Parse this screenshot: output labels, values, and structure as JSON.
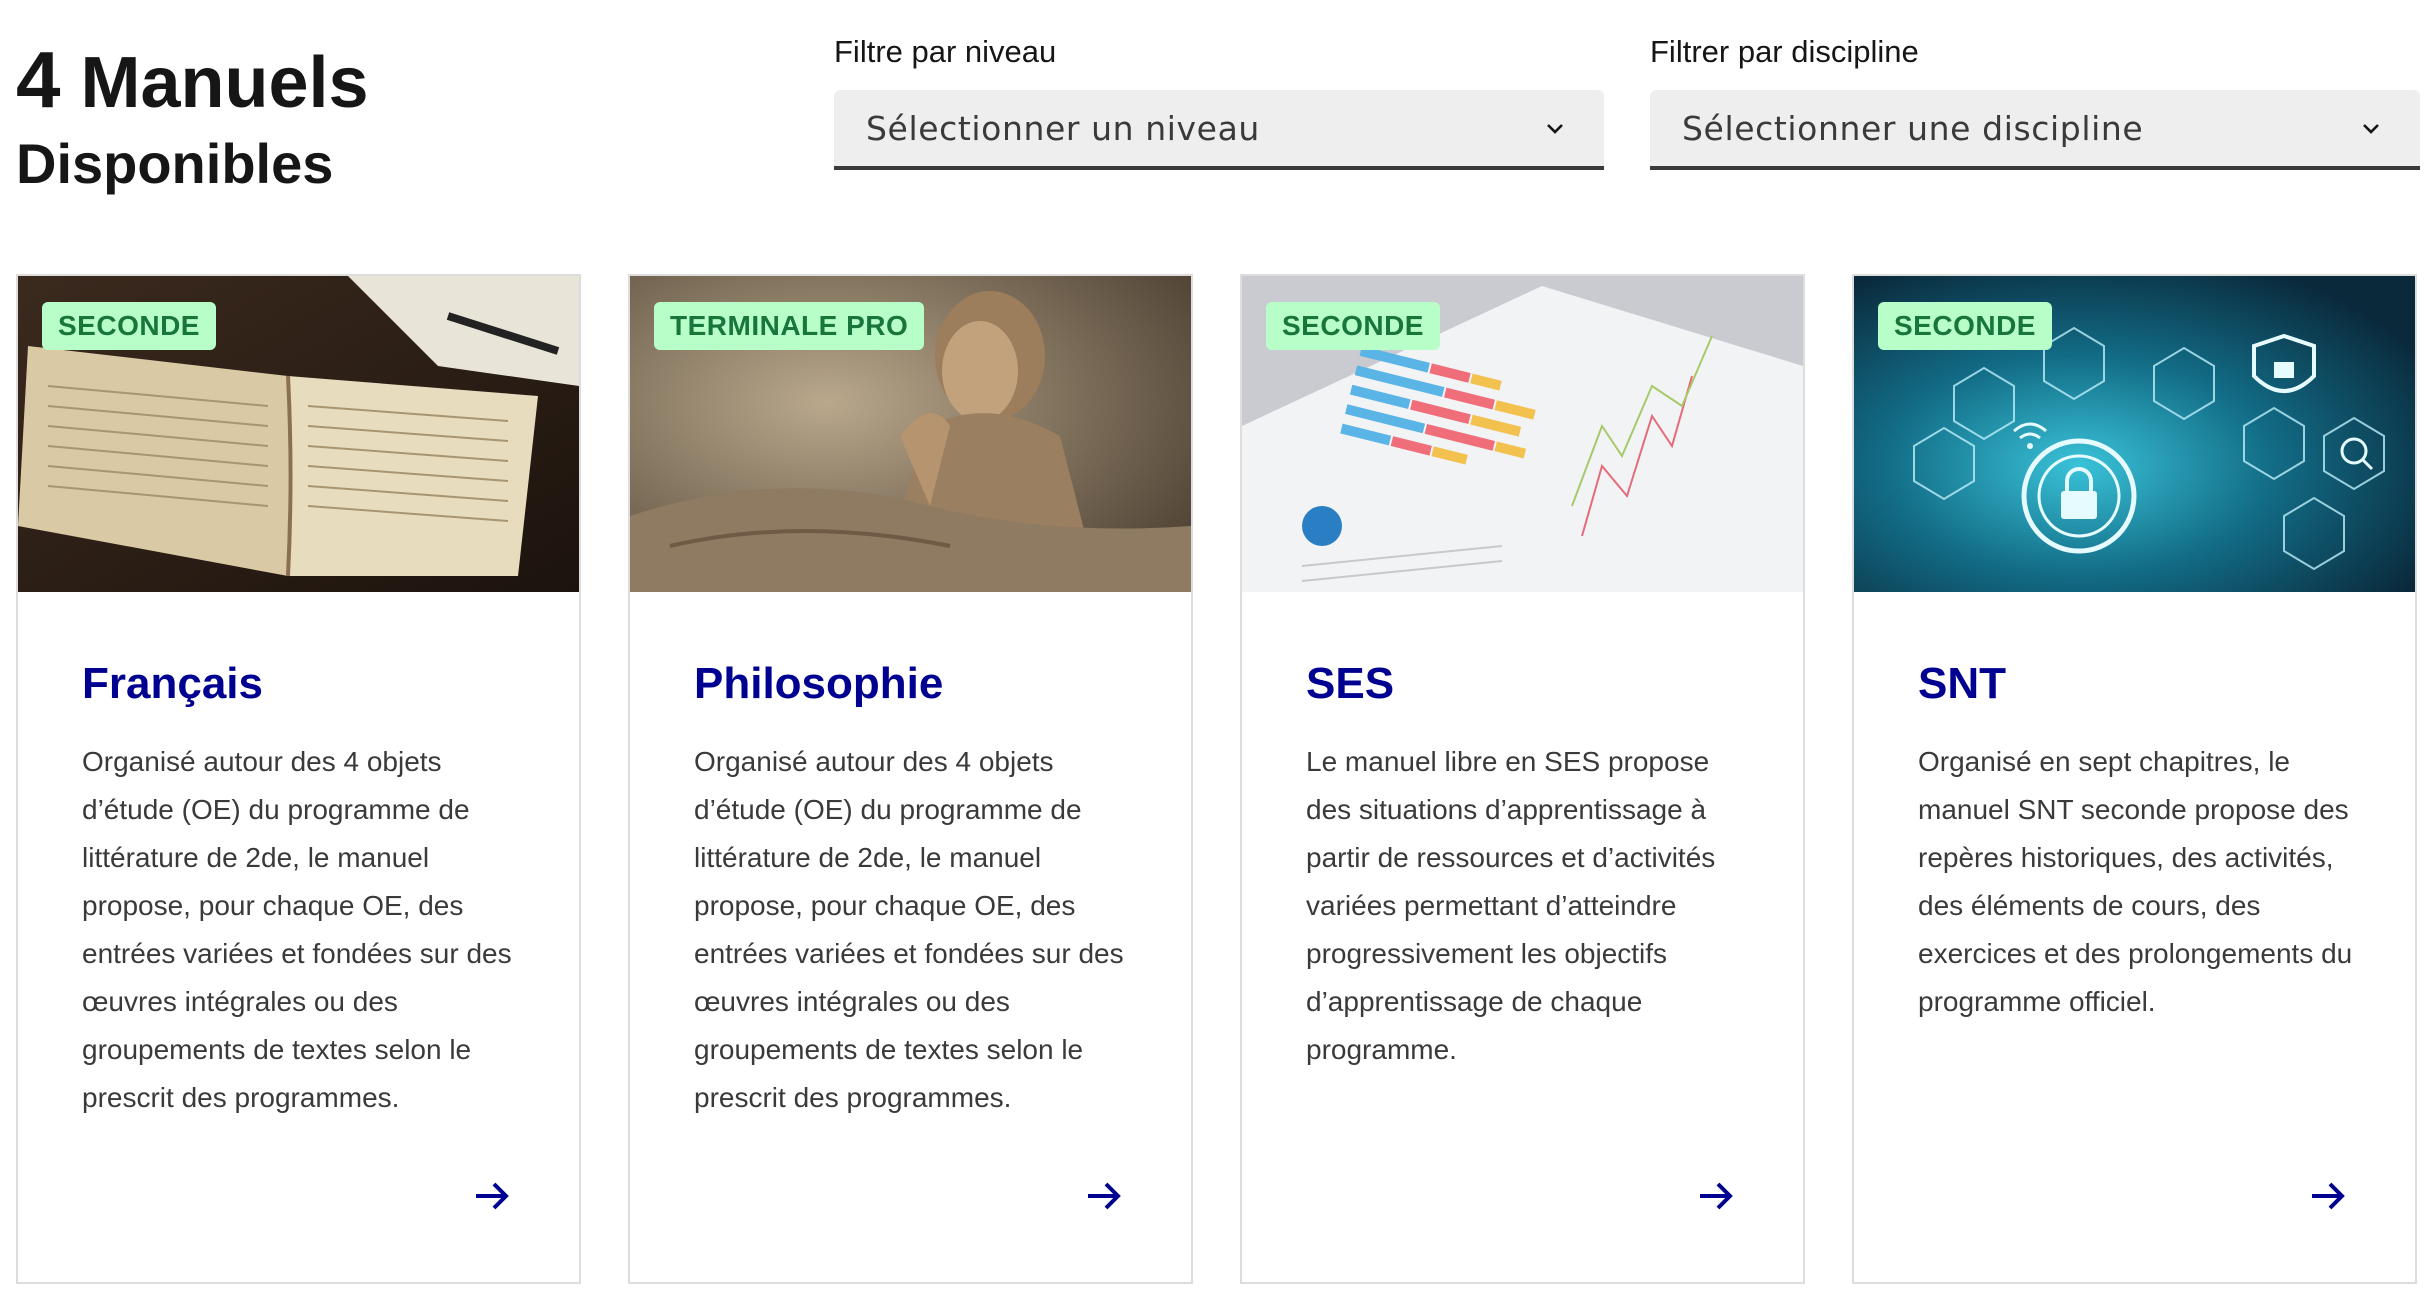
{
  "header": {
    "count": "4",
    "title_word": "Manuels",
    "subtitle": "Disponibles"
  },
  "filters": [
    {
      "label": "Filtre par niveau",
      "value": "Sélectionner un niveau"
    },
    {
      "label": "Filtrer par discipline",
      "value": "Sélectionner une discipline"
    }
  ],
  "cards": [
    {
      "badge": "SECONDE",
      "title": "Français",
      "description": "Organisé autour des 4 objets d’étude (OE) du programme de littérature de 2de, le manuel propose, pour chaque OE, des entrées variées et fondées sur des œuvres intégrales ou des groupements de textes selon le prescrit des programmes.",
      "image_icon": "open-book-image"
    },
    {
      "badge": "TERMINALE PRO",
      "title": "Philosophie",
      "description": "Organisé autour des 4 objets d’étude (OE) du programme de littérature de 2de, le manuel propose, pour chaque OE, des entrées variées et fondées sur des œuvres intégrales ou des groupements de textes selon le prescrit des programmes.",
      "image_icon": "statue-image"
    },
    {
      "badge": "SECONDE",
      "title": "SES",
      "description": "Le manuel libre en SES propose des situations d’apprentissage à partir de ressources et d’activités variées permettant d’atteindre progressivement les objectifs d’apprentissage de chaque programme.",
      "image_icon": "charts-document-image"
    },
    {
      "badge": "SECONDE",
      "title": "SNT",
      "description": "Organisé en sept chapitres, le manuel SNT seconde propose des repères historiques, des activités, des éléments de cours, des exercices et des prolongements du programme officiel.",
      "image_icon": "cybersecurity-image"
    }
  ],
  "colors": {
    "title_blue": "#000091",
    "badge_bg": "#b8fec9",
    "badge_text": "#18753c",
    "select_bg": "#eeeeee"
  }
}
